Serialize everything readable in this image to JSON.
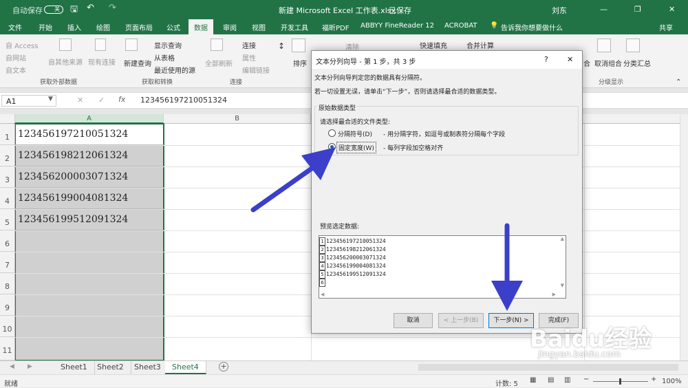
{
  "title_bar": {
    "autosave": "自动保存",
    "autosave_state": "关",
    "file_title": "新建 Microsoft Excel 工作表.xlsx",
    "saved_state": "已保存",
    "user": "刘东"
  },
  "ribbon_tabs": [
    "文件",
    "开始",
    "插入",
    "绘图",
    "页面布局",
    "公式",
    "数据",
    "审阅",
    "视图",
    "开发工具",
    "福昕PDF",
    "ABBYY FineReader 12",
    "ACROBAT"
  ],
  "tell_me": "告诉我你想要做什么",
  "share": "共享",
  "ribbon": {
    "get_external": {
      "items": [
        "自 Access",
        "自网站",
        "自文本",
        "自其他来源",
        "现有连接"
      ],
      "group": "获取外部数据"
    },
    "get_transform": {
      "new_query": "新建查询",
      "items": [
        "显示查询",
        "从表格",
        "最近使用的源"
      ],
      "group": "获取和转换"
    },
    "connections": {
      "refresh": "全部刷新",
      "items": [
        "连接",
        "属性",
        "编辑链接"
      ],
      "group": "连接"
    },
    "sort": "排序",
    "filter": {
      "clear": "清除"
    },
    "tools": {
      "flash_fill": "快速填充",
      "consolidate": "合并计算"
    },
    "outline": {
      "items": [
        "合",
        "取消组合",
        "分类汇总"
      ],
      "group": "分级显示"
    }
  },
  "formula_bar": {
    "name_box": "A1",
    "formula": "123456197210051324",
    "fx": "fx"
  },
  "columns": [
    "A",
    "B"
  ],
  "rows": [
    "1",
    "2",
    "3",
    "4",
    "5",
    "6",
    "7",
    "8",
    "9",
    "10",
    "11"
  ],
  "cells": [
    "123456197210051324",
    "123456198212061324",
    "123456200003071324",
    "123456199004081324",
    "123456199512091324"
  ],
  "dialog": {
    "title": "文本分列向导 - 第 1 步，共 3 步",
    "help": "?",
    "close": "✕",
    "intro": "文本分列向导判定您的数据具有分隔符。",
    "hint": "若一切设置无误，请单击“下一步”，否则请选择最合适的数据类型。",
    "section": "原始数据类型",
    "choose": "请选择最合适的文件类型:",
    "option_delim": "分隔符号(D)",
    "option_delim_desc": "- 用分隔字符，如逗号或制表符分隔每个字段",
    "option_fixed": "固定宽度(W)",
    "option_fixed_desc": "- 每列字段加空格对齐",
    "selected": "fixed",
    "preview_label": "预览选定数据:",
    "preview_rows": [
      {
        "n": "1",
        "text": "123456197210051324"
      },
      {
        "n": "2",
        "text": "123456198212061324"
      },
      {
        "n": "3",
        "text": "123456200003071324"
      },
      {
        "n": "4",
        "text": "123456199004081324"
      },
      {
        "n": "5",
        "text": "123456199512091324"
      },
      {
        "n": "6",
        "text": ""
      }
    ],
    "buttons": {
      "cancel": "取消",
      "back": "< 上一步(B)",
      "next": "下一步(N) >",
      "finish": "完成(F)"
    }
  },
  "sheets": [
    "Sheet1",
    "Sheet2",
    "Sheet3",
    "Sheet4"
  ],
  "active_sheet": "Sheet4",
  "status": {
    "mode": "就绪",
    "count": "计数: 5",
    "zoom": "100%"
  },
  "watermark": {
    "brand": "Baidu经验",
    "url": "jingyan.baidu.com"
  },
  "colors": {
    "excel_green": "#217346",
    "arrow": "#3b3fc9"
  }
}
